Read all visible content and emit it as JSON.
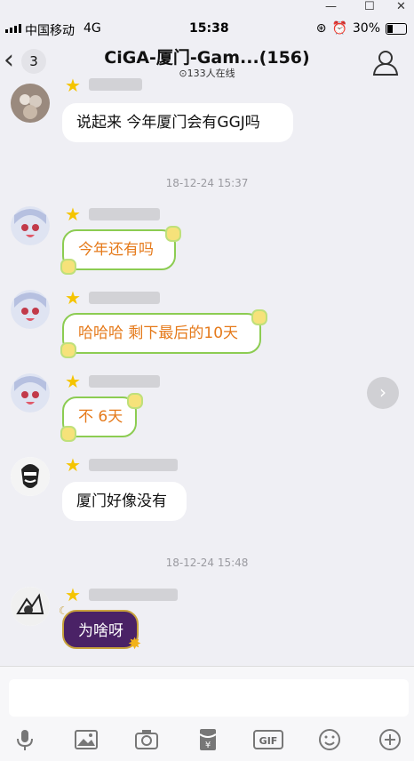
{
  "window_controls": {
    "minimize": "—",
    "maximize": "☐",
    "close": "✕"
  },
  "status_bar": {
    "carrier": "中国移动",
    "network": "4G",
    "time": "15:38",
    "battery": "30%"
  },
  "header": {
    "back_count": "3",
    "title": "CiGA-厦门-Gam...(156)",
    "online": "133人在线"
  },
  "messages": [
    {
      "text": "说起来 今年厦门会有GGJ吗"
    },
    {
      "timestamp": "18-12-24 15:37"
    },
    {
      "text": "今年还有吗"
    },
    {
      "text": "哈哈哈 剩下最后的10天"
    },
    {
      "text": "不 6天"
    },
    {
      "text": "厦门好像没有"
    },
    {
      "timestamp": "18-12-24 15:48"
    },
    {
      "text": "为啥呀"
    }
  ],
  "input": {
    "placeholder": ""
  },
  "toolbar": {
    "icons": [
      "microphone-icon",
      "image-icon",
      "camera-icon",
      "red-packet-icon",
      "gif-icon",
      "emoji-icon",
      "plus-icon"
    ],
    "gif_label": "GIF"
  },
  "colors": {
    "background": "#efeff4",
    "flower_text": "#e57a1b",
    "flower_border": "#8ccc52",
    "purple_bubble": "#4a2266"
  }
}
